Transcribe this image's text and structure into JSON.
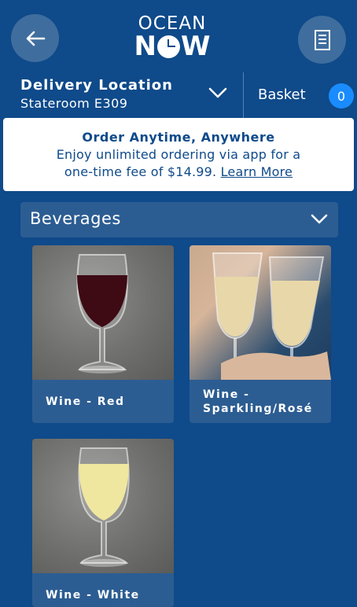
{
  "header": {
    "logo_top": "OCEAN",
    "logo_bottom_left": "N",
    "logo_bottom_right": "W",
    "back_icon": "arrow-left-icon",
    "menu_icon": "receipt-icon"
  },
  "location": {
    "title": "Delivery Location",
    "value": "Stateroom E309",
    "basket_label": "Basket",
    "basket_count": "0"
  },
  "banner": {
    "title": "Order Anytime, Anywhere",
    "line1": "Enjoy unlimited ordering via app for a",
    "line2": "one-time fee of $14.99.",
    "link": "Learn More"
  },
  "category": {
    "label": "Beverages"
  },
  "products": [
    {
      "label": "Wine - Red"
    },
    {
      "label_line1": "Wine -",
      "label_line2": "Sparkling/Rosé"
    },
    {
      "label": "Wine - White"
    }
  ],
  "colors": {
    "background": "#0f4a8a",
    "card": "#2c5d92",
    "badge": "#1a8cff"
  }
}
